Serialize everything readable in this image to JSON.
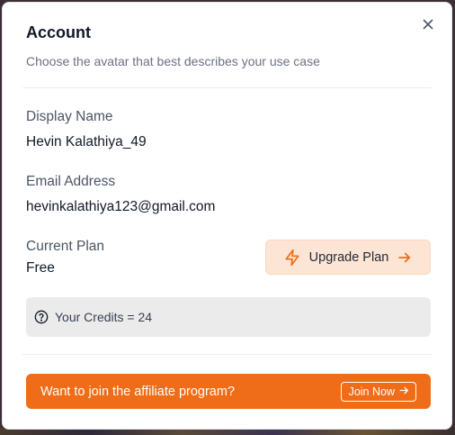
{
  "modal": {
    "title": "Account",
    "subtitle": "Choose the avatar that best describes your use case",
    "close_icon": "close-icon"
  },
  "fields": {
    "display_name_label": "Display Name",
    "display_name_value": "Hevin Kalathiya_49",
    "email_label": "Email Address",
    "email_value": "hevinkalathiya123@gmail.com",
    "plan_label": "Current Plan",
    "plan_value": "Free"
  },
  "upgrade": {
    "label": "Upgrade Plan",
    "icon": "lightning-icon",
    "arrow_icon": "arrow-right-icon",
    "accent": "#ef6c18"
  },
  "credits": {
    "text": "Your Credits = 24",
    "icon": "help-circle-icon"
  },
  "affiliate": {
    "text": "Want to join the affiliate program?",
    "button_label": "Join Now",
    "background": "#ef6c18"
  }
}
